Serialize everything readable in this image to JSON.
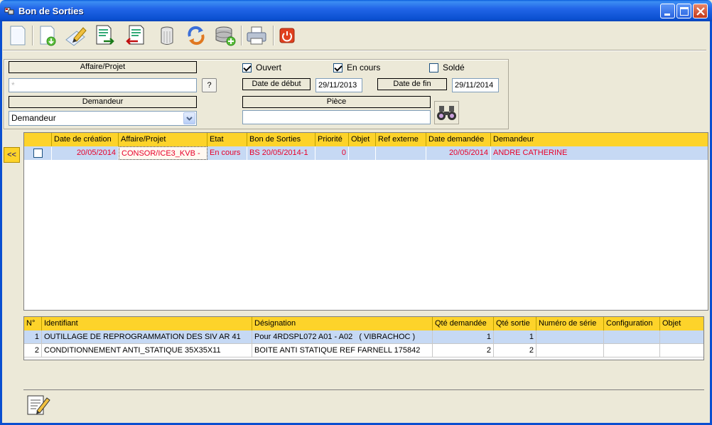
{
  "window": {
    "title": "Bon de Sorties"
  },
  "filters": {
    "affaire_label": "Affaire/Projet",
    "affaire_value": "*",
    "help_button": "?",
    "demandeur_label": "Demandeur",
    "demandeur_value": "Demandeur",
    "ouvert_label": "Ouvert",
    "ouvert_checked": true,
    "en_cours_label": "En cours",
    "en_cours_checked": true,
    "solde_label": "Soldé",
    "solde_checked": false,
    "date_debut_label": "Date de début",
    "date_debut_value": "29/11/2013",
    "date_fin_label": "Date de fin",
    "date_fin_value": "29/11/2014",
    "piece_label": "Pièce",
    "piece_value": ""
  },
  "collapse_button": "<<",
  "orders": {
    "columns": [
      "Date de création",
      "Affaire/Projet",
      "Etat",
      "Bon de Sorties",
      "Priorité",
      "Objet",
      "Ref externe",
      "Date demandée",
      "Demandeur"
    ],
    "rows": [
      {
        "date_creation": "20/05/2014",
        "affaire": "CONSOR/ICE3_KVB -",
        "etat": "En cours",
        "bon": "BS 20/05/2014-1",
        "priorite": "0",
        "objet": "",
        "ref_externe": "",
        "date_demandee": "20/05/2014",
        "demandeur": "ANDRE CATHERINE"
      }
    ]
  },
  "lines": {
    "columns": [
      "N°",
      "Identifiant",
      "Désignation",
      "Qté demandée",
      "Qté sortie",
      "Numéro de série",
      "Configuration",
      "Objet"
    ],
    "rows": [
      {
        "n": "1",
        "identifiant": "OUTILLAGE DE REPROGRAMMATION DES SIV AR 41",
        "designation": "Pour 4RDSPL072 A01 - A02   ( VIBRACHOC )",
        "qte_demandee": "1",
        "qte_sortie": "1",
        "numero_serie": "",
        "configuration": "",
        "objet": ""
      },
      {
        "n": "2",
        "identifiant": "CONDITIONNEMENT ANTI_STATIQUE 35X35X11",
        "designation": "BOITE ANTI STATIQUE REF FARNELL 175842",
        "qte_demandee": "2",
        "qte_sortie": "2",
        "numero_serie": "",
        "configuration": "",
        "objet": ""
      }
    ]
  }
}
